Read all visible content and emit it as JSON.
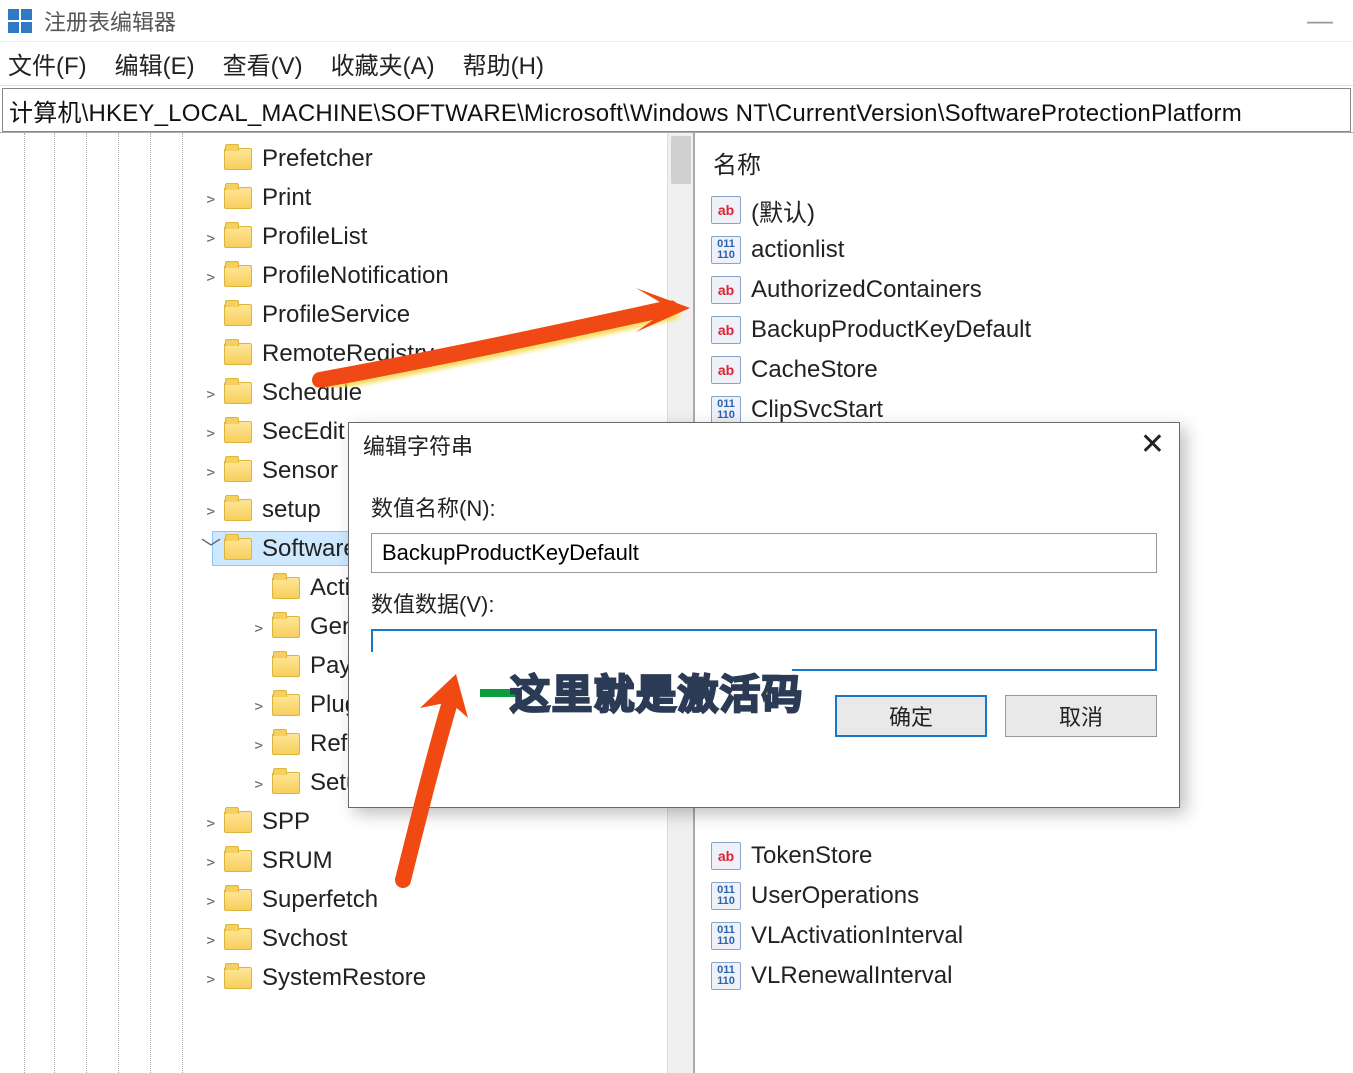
{
  "window": {
    "title": "注册表编辑器",
    "minimize_glyph": "—"
  },
  "menu": {
    "file": "文件(F)",
    "edit": "编辑(E)",
    "view": "查看(V)",
    "favorites": "收藏夹(A)",
    "help": "帮助(H)"
  },
  "address_bar": "计算机\\HKEY_LOCAL_MACHINE\\SOFTWARE\\Microsoft\\Windows NT\\CurrentVersion\\SoftwareProtectionPlatform",
  "tree": [
    {
      "label": "Prefetcher",
      "exp": "",
      "level": 0
    },
    {
      "label": "Print",
      "exp": ">",
      "level": 0
    },
    {
      "label": "ProfileList",
      "exp": ">",
      "level": 0
    },
    {
      "label": "ProfileNotification",
      "exp": ">",
      "level": 0
    },
    {
      "label": "ProfileService",
      "exp": "",
      "level": 0
    },
    {
      "label": "RemoteRegistry",
      "exp": "",
      "level": 0
    },
    {
      "label": "Schedule",
      "exp": ">",
      "level": 0
    },
    {
      "label": "SecEdit",
      "exp": ">",
      "level": 0
    },
    {
      "label": "Sensor",
      "exp": ">",
      "level": 0
    },
    {
      "label": "setup",
      "exp": ">",
      "level": 0
    },
    {
      "label": "Software",
      "exp": "v",
      "level": 0,
      "selected": true,
      "partial": true
    },
    {
      "label": "Activa",
      "exp": "",
      "level": 1,
      "partial": true
    },
    {
      "label": "Genui",
      "exp": ">",
      "level": 1,
      "partial": true
    },
    {
      "label": "Payloa",
      "exp": "",
      "level": 1,
      "partial": true
    },
    {
      "label": "Plugin",
      "exp": ">",
      "level": 1,
      "partial": true
    },
    {
      "label": "Referr",
      "exp": ">",
      "level": 1,
      "partial": true
    },
    {
      "label": "Setup",
      "exp": ">",
      "level": 1,
      "partial": true
    },
    {
      "label": "SPP",
      "exp": ">",
      "level": 0
    },
    {
      "label": "SRUM",
      "exp": ">",
      "level": 0
    },
    {
      "label": "Superfetch",
      "exp": ">",
      "level": 0
    },
    {
      "label": "Svchost",
      "exp": ">",
      "level": 0
    },
    {
      "label": "SystemRestore",
      "exp": ">",
      "level": 0
    }
  ],
  "values": {
    "column_name": "名称",
    "rows": [
      {
        "icon": "ab",
        "label": "(默认)"
      },
      {
        "icon": "bin",
        "label": "actionlist"
      },
      {
        "icon": "ab",
        "label": "AuthorizedContainers"
      },
      {
        "icon": "ab",
        "label": "BackupProductKeyDefault"
      },
      {
        "icon": "ab",
        "label": "CacheStore"
      },
      {
        "icon": "bin",
        "label": "ClipSvcStart"
      },
      {
        "icon": "ab",
        "label": "TokenStore"
      },
      {
        "icon": "bin",
        "label": "UserOperations"
      },
      {
        "icon": "bin",
        "label": "VLActivationInterval"
      },
      {
        "icon": "bin",
        "label": "VLRenewalInterval"
      }
    ]
  },
  "dialog": {
    "title": "编辑字符串",
    "close_glyph": "✕",
    "name_label": "数值名称(N):",
    "name_value": "BackupProductKeyDefault",
    "data_label": "数值数据(V):",
    "data_value": "",
    "ok": "确定",
    "cancel": "取消"
  },
  "annotations": {
    "callout_text": "这里就是激活码"
  }
}
